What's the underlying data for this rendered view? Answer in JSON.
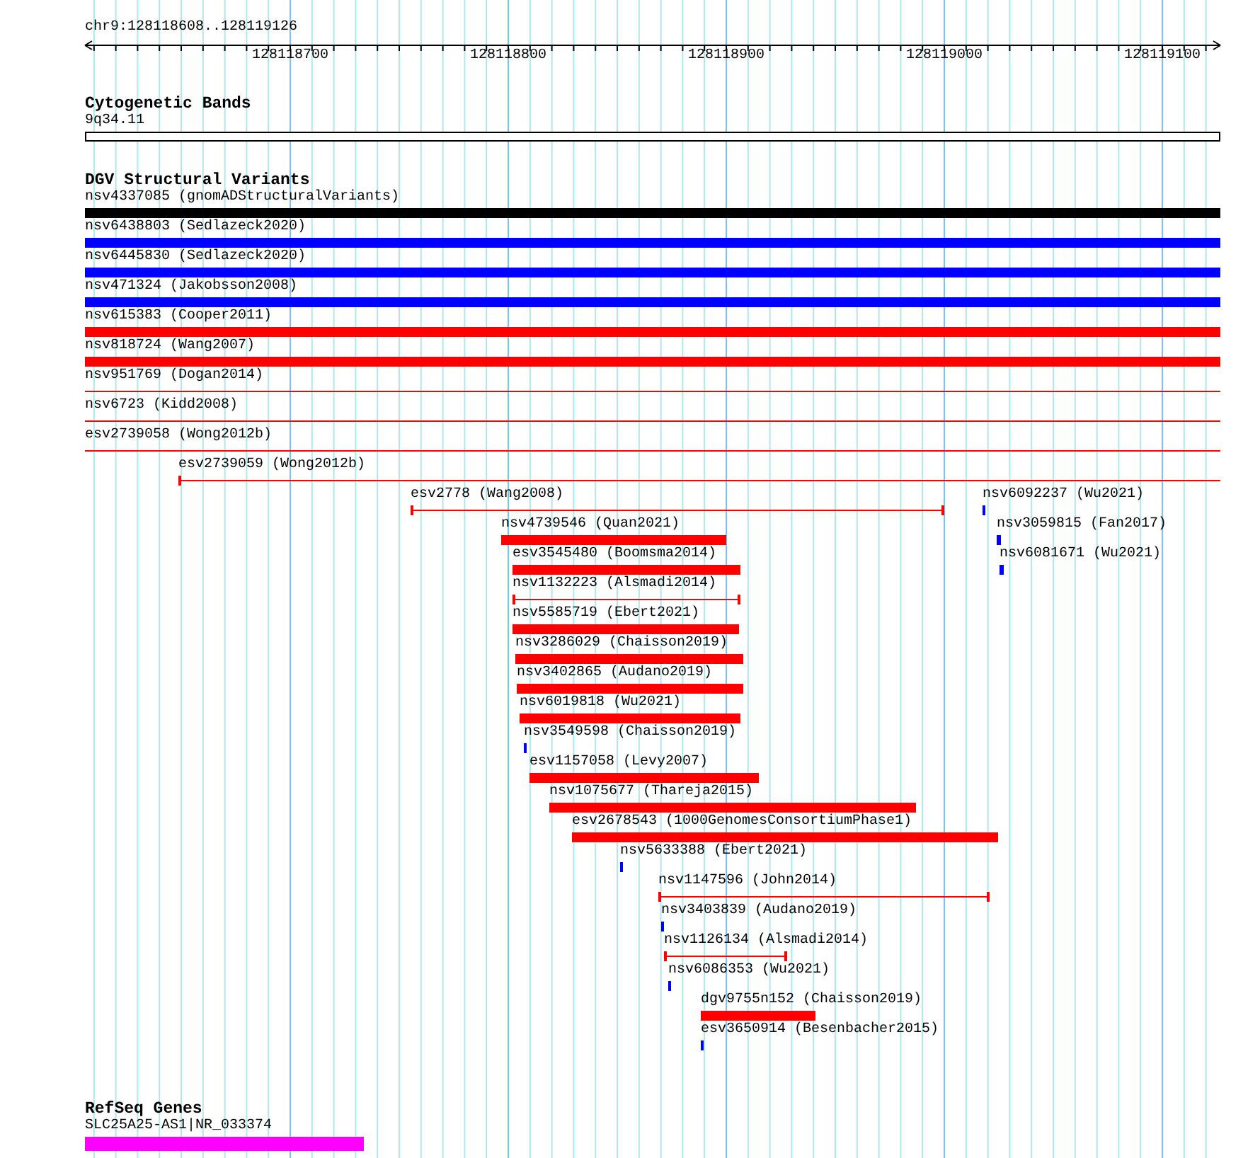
{
  "ruler": {
    "location": "chr9:128118608..128119126",
    "ticks": [
      "128118700",
      "128118800",
      "128118900",
      "128119000",
      "128119100"
    ]
  },
  "cytogenetic_bands": {
    "title": "Cytogenetic Bands",
    "bands": [
      {
        "label": "9q34.11"
      }
    ]
  },
  "dgv_structural_variants": {
    "title": "DGV Structural Variants",
    "features": [
      {
        "label": "nsv4337085 (gnomADStructuralVariants)",
        "kind": "bar",
        "color": "#000000"
      },
      {
        "label": "nsv6438803 (Sedlazeck2020)",
        "kind": "bar",
        "color": "#0000ff"
      },
      {
        "label": "nsv6445830 (Sedlazeck2020)",
        "kind": "bar",
        "color": "#0000ff"
      },
      {
        "label": "nsv471324 (Jakobsson2008)",
        "kind": "bar",
        "color": "#0000ff"
      },
      {
        "label": "nsv615383 (Cooper2011)",
        "kind": "bar",
        "color": "#ff0000"
      },
      {
        "label": "nsv818724 (Wang2007)",
        "kind": "bar",
        "color": "#ff0000"
      },
      {
        "label": "nsv951769 (Dogan2014)",
        "kind": "span",
        "color": "#ff0000"
      },
      {
        "label": "nsv6723 (Kidd2008)",
        "kind": "span",
        "color": "#ff0000"
      },
      {
        "label": "esv2739058 (Wong2012b)",
        "kind": "span",
        "color": "#ff0000"
      },
      {
        "label": "esv2739059 (Wong2012b)",
        "kind": "span",
        "color": "#ff0000"
      },
      {
        "label": "esv2778 (Wang2008)",
        "kind": "span",
        "color": "#ff0000"
      },
      {
        "label": "nsv6092237 (Wu2021)",
        "kind": "point",
        "color": "#0000ff"
      },
      {
        "label": "nsv4739546 (Quan2021)",
        "kind": "bar",
        "color": "#ff0000"
      },
      {
        "label": "nsv3059815 (Fan2017)",
        "kind": "point",
        "color": "#0000ff"
      },
      {
        "label": "esv3545480 (Boomsma2014)",
        "kind": "bar",
        "color": "#ff0000"
      },
      {
        "label": "nsv6081671 (Wu2021)",
        "kind": "point",
        "color": "#0000ff"
      },
      {
        "label": "nsv1132223 (Alsmadi2014)",
        "kind": "span",
        "color": "#ff0000"
      },
      {
        "label": "nsv5585719 (Ebert2021)",
        "kind": "bar",
        "color": "#ff0000"
      },
      {
        "label": "nsv3286029 (Chaisson2019)",
        "kind": "bar",
        "color": "#ff0000"
      },
      {
        "label": "nsv3402865 (Audano2019)",
        "kind": "bar",
        "color": "#ff0000"
      },
      {
        "label": "nsv6019818 (Wu2021)",
        "kind": "bar",
        "color": "#ff0000"
      },
      {
        "label": "nsv3549598 (Chaisson2019)",
        "kind": "point",
        "color": "#0000ff"
      },
      {
        "label": "esv1157058 (Levy2007)",
        "kind": "bar",
        "color": "#ff0000"
      },
      {
        "label": "nsv1075677 (Thareja2015)",
        "kind": "bar",
        "color": "#ff0000"
      },
      {
        "label": "esv2678543 (1000GenomesConsortiumPhase1)",
        "kind": "bar",
        "color": "#ff0000"
      },
      {
        "label": "nsv5633388 (Ebert2021)",
        "kind": "point",
        "color": "#0000ff"
      },
      {
        "label": "nsv1147596 (John2014)",
        "kind": "span",
        "color": "#ff0000"
      },
      {
        "label": "nsv3403839 (Audano2019)",
        "kind": "point",
        "color": "#0000ff"
      },
      {
        "label": "nsv1126134 (Alsmadi2014)",
        "kind": "span",
        "color": "#ff0000"
      },
      {
        "label": "nsv6086353 (Wu2021)",
        "kind": "point",
        "color": "#0000ff"
      },
      {
        "label": "dgv9755n152 (Chaisson2019)",
        "kind": "bar",
        "color": "#ff0000"
      },
      {
        "label": "esv3650914 (Besenbacher2015)",
        "kind": "point",
        "color": "#0000ff"
      }
    ]
  },
  "refseq_genes": {
    "title": "RefSeq Genes",
    "genes": [
      {
        "label": "SLC25A25-AS1|NR_033374",
        "color": "#ff00ff"
      }
    ]
  }
}
